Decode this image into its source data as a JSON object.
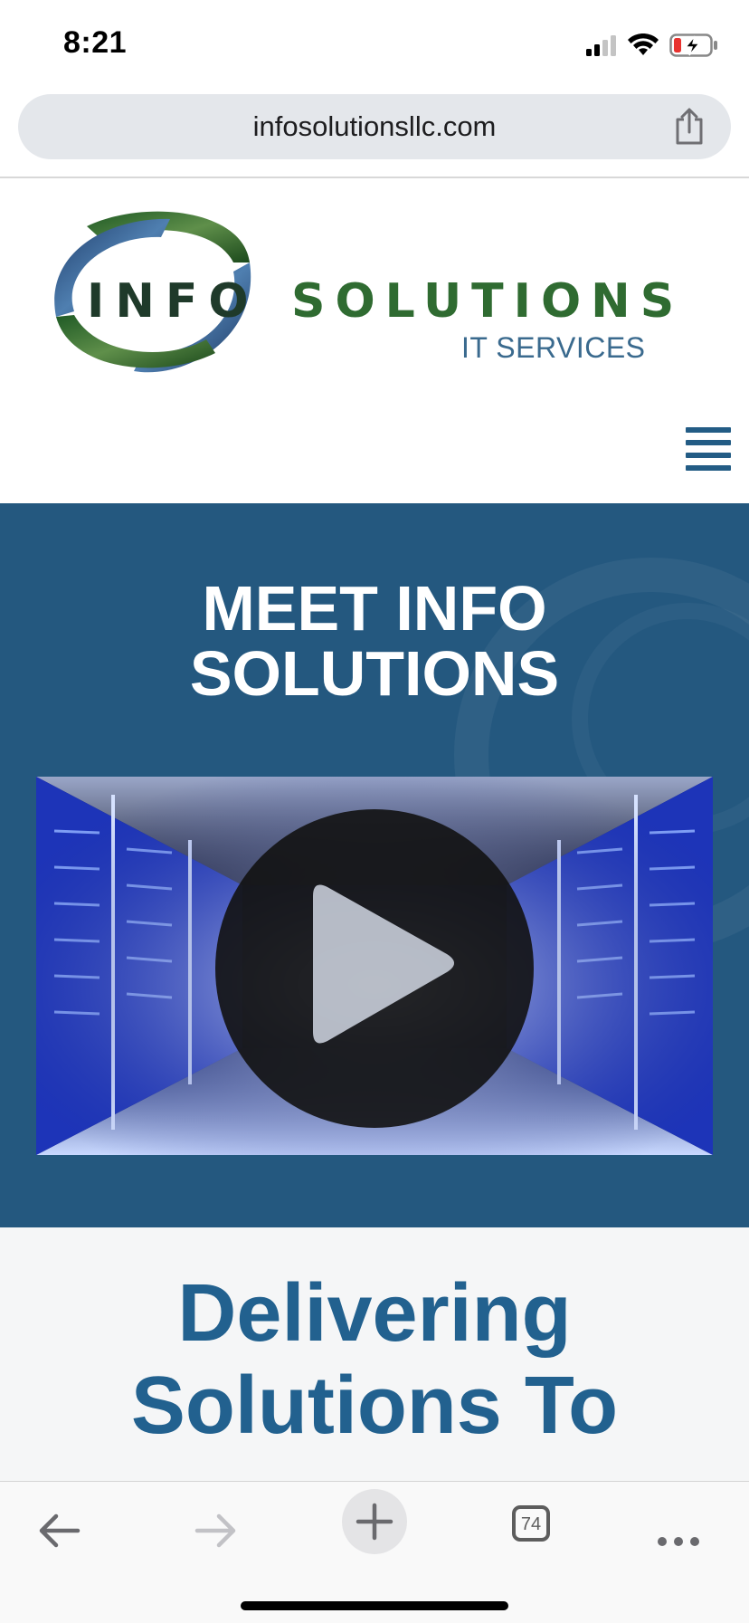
{
  "status_bar": {
    "time": "8:21"
  },
  "browser": {
    "url": "infosolutionsllc.com",
    "tab_count": "74"
  },
  "logo": {
    "word1": "INFO",
    "word2": "SOLUTIONS",
    "tagline": "IT SERVICES"
  },
  "hero": {
    "title_line1": "MEET INFO",
    "title_line2": "SOLUTIONS"
  },
  "section": {
    "title_line1": "Delivering",
    "title_line2": "Solutions To"
  },
  "colors": {
    "brand_blue": "#24587f",
    "title_blue": "#22618f",
    "logo_green": "#2f6b31"
  },
  "icons": [
    "signal-icon",
    "wifi-icon",
    "battery-icon",
    "share-icon",
    "menu-icon",
    "play-icon",
    "back-icon",
    "forward-icon",
    "new-tab-icon",
    "tabs-icon",
    "more-icon"
  ]
}
